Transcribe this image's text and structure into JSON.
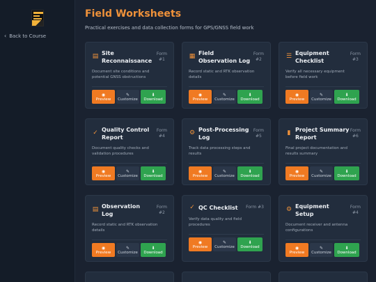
{
  "sidebar": {
    "back_label": "Back to Course",
    "back_icon": "chevron-left-icon"
  },
  "header": {
    "title": "Field Worksheets",
    "subtitle": "Practical exercises and data collection forms for GPS/GNSS field work"
  },
  "buttons": {
    "preview": "Preview",
    "customize": "Customize",
    "download": "Download"
  },
  "cards": [
    {
      "title_1": "Site",
      "title_2": "Reconnaissance",
      "form_1": "Form",
      "form_2": "#1",
      "desc_1": "Document site conditions and",
      "desc_2": "potential GNSS obstructions",
      "icon": "clipboard-icon"
    },
    {
      "title_1": "Field",
      "title_2": "Observation Log",
      "form_1": "Form",
      "form_2": "#2",
      "desc_1": "Record static and RTK observation",
      "desc_2": "details",
      "icon": "table-icon"
    },
    {
      "title_1": "Equipment",
      "title_2": "Checklist",
      "form_1": "Form",
      "form_2": "#3",
      "desc_1": "Verify all necessary equipment",
      "desc_2": "before field work",
      "icon": "checklist-icon"
    },
    {
      "title_1": "Quality Control",
      "title_2": "Report",
      "form_1": "Form",
      "form_2": "#4",
      "desc_1": "Document quality checks and",
      "desc_2": "validation procedures",
      "icon": "double-check-icon"
    },
    {
      "title_1": "Post-Processing",
      "title_2": "Log",
      "form_1": "Form",
      "form_2": "#5",
      "desc_1": "Track data processing steps and",
      "desc_2": "results",
      "icon": "gear-icon"
    },
    {
      "title_1": "Project Summary",
      "title_2": "Report",
      "form_1": "Form",
      "form_2": "#6",
      "desc_1": "Final project documentation and",
      "desc_2": "results summary",
      "icon": "file-icon"
    },
    {
      "title_1": "Observation",
      "title_2": "Log",
      "form_1": "Form",
      "form_2": "#2",
      "desc_1": "Record static and RTK observation",
      "desc_2": "details",
      "icon": "clipboard-icon"
    },
    {
      "title_1": "QC Checklist",
      "title_2": "",
      "form_1": "Form #3",
      "form_2": "",
      "desc_1": "Verify data quality and field",
      "desc_2": "procedures",
      "icon": "double-check-icon"
    },
    {
      "title_1": "Equipment",
      "title_2": "Setup",
      "form_1": "Form",
      "form_2": "#4",
      "desc_1": "Document receiver and antenna",
      "desc_2": "configurations",
      "icon": "gears-icon"
    }
  ]
}
